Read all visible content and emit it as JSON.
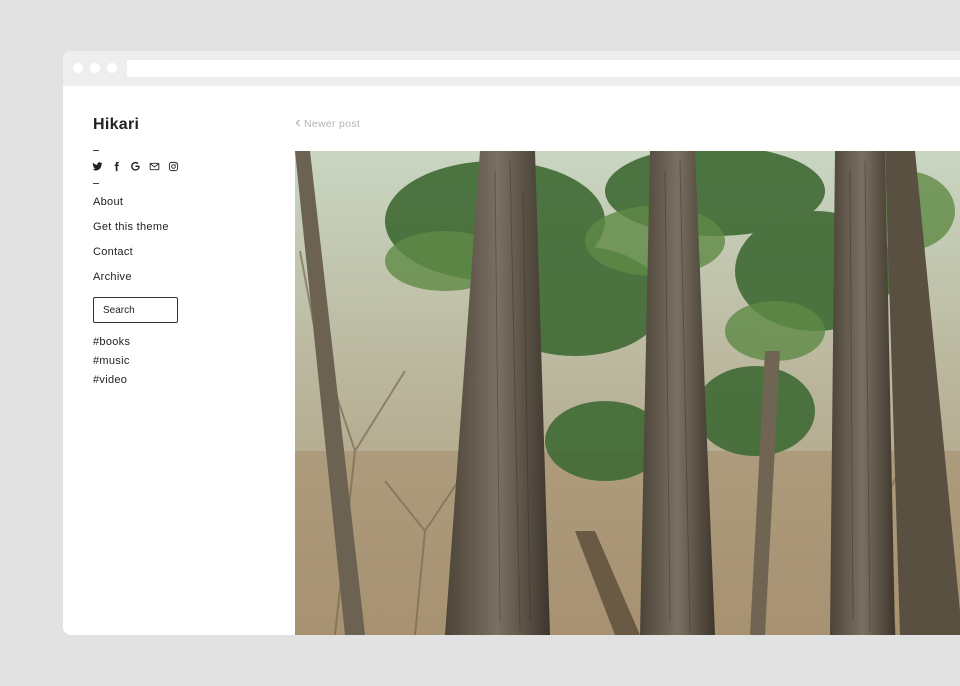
{
  "site": {
    "title": "Hikari"
  },
  "social_icons": [
    "twitter-icon",
    "facebook-icon",
    "google-icon",
    "mail-icon",
    "instagram-icon"
  ],
  "nav": {
    "items": [
      "About",
      "Get this theme",
      "Contact",
      "Archive"
    ]
  },
  "search": {
    "placeholder": "Search"
  },
  "tags": [
    "#books",
    "#music",
    "#video"
  ],
  "post": {
    "newer_label": "Newer post",
    "image_subject": "forest-trees-photo"
  },
  "colors": {
    "page_bg": "#e2e2e2",
    "window_bg": "#ffffff",
    "titlebar": "#eeeeee",
    "muted_link": "#b5b5b5",
    "text": "#222222"
  }
}
